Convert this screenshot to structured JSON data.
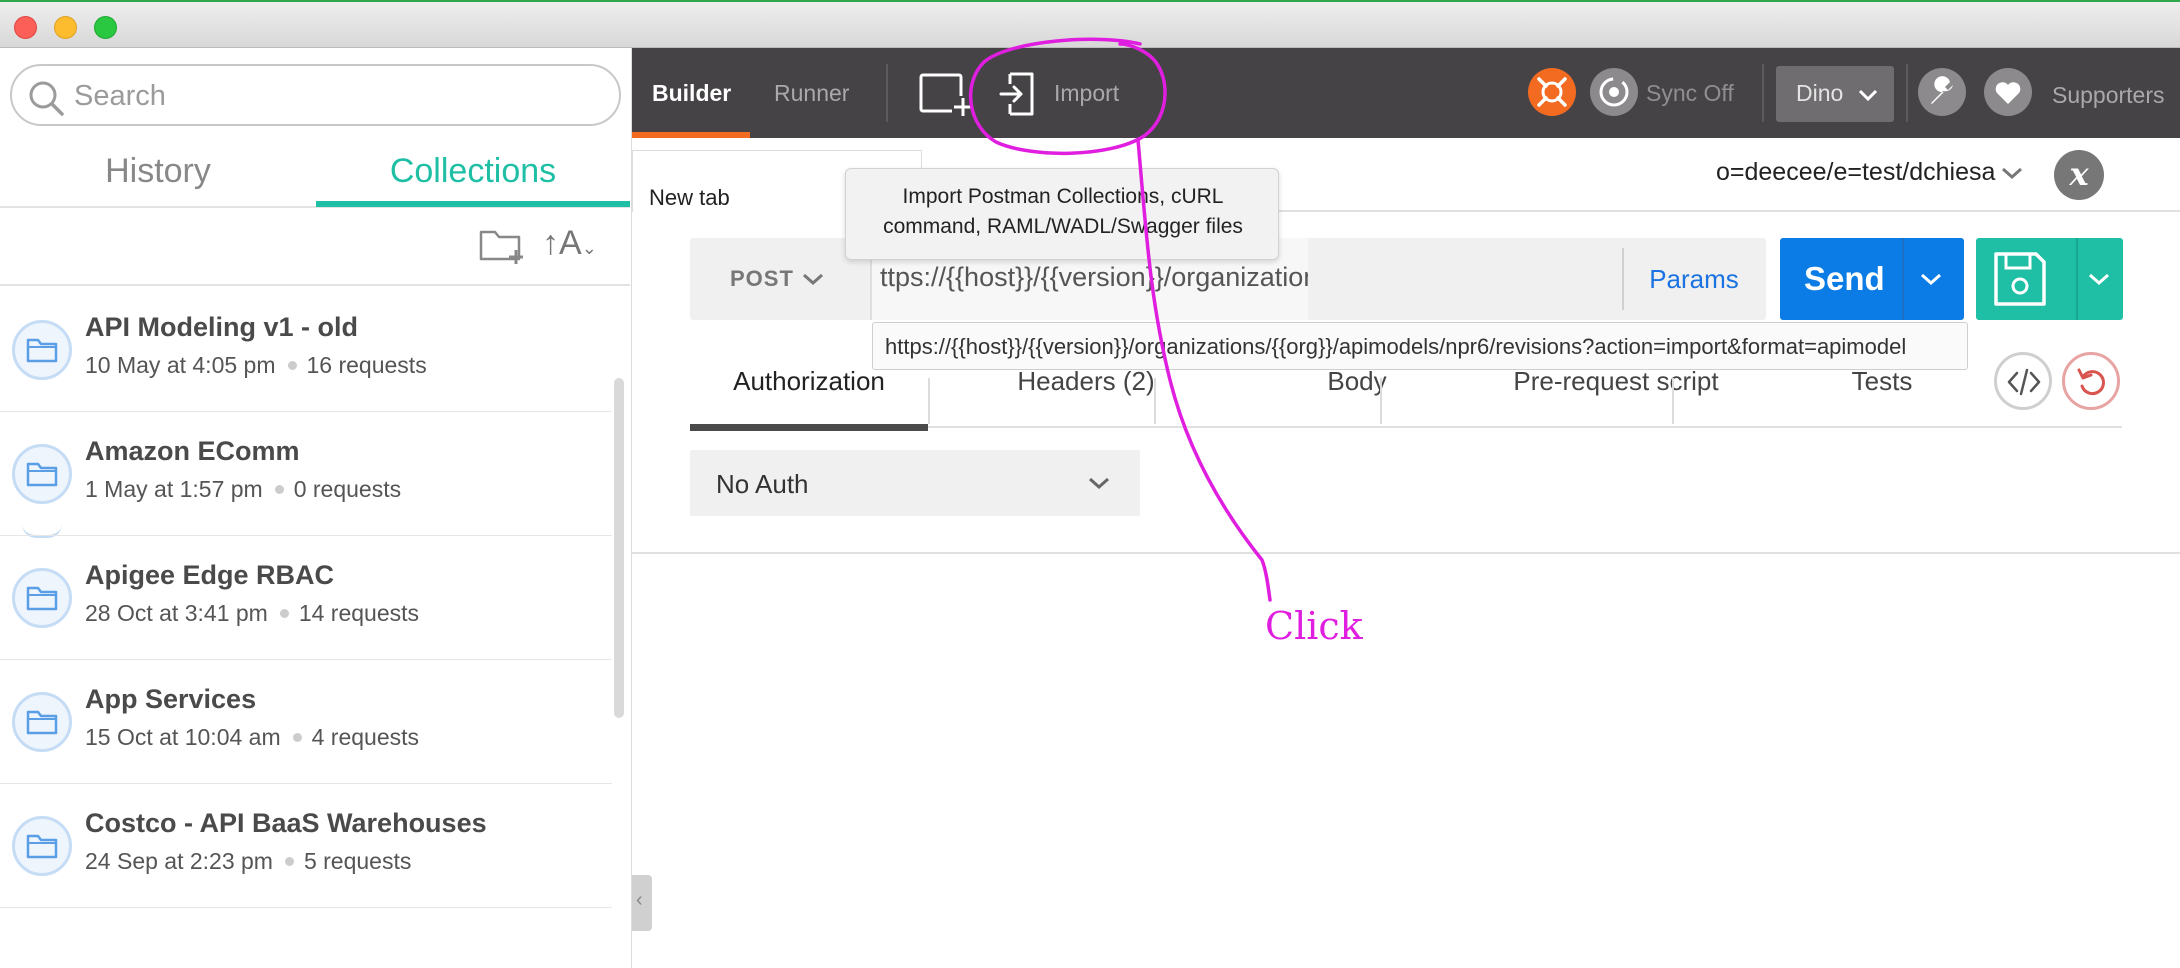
{
  "sidebar": {
    "search_placeholder": "Search",
    "tabs": {
      "history": "History",
      "collections": "Collections"
    },
    "sort_label": "↑A",
    "collections": [
      {
        "name": "API Modeling v1 - old",
        "date": "10 May at 4:05 pm",
        "requests": "16 requests"
      },
      {
        "name": "Amazon EComm",
        "date": "1 May at 1:57 pm",
        "requests": "0 requests"
      },
      {
        "name": "Apigee Edge RBAC",
        "date": "28 Oct at 3:41 pm",
        "requests": "14 requests"
      },
      {
        "name": "App Services",
        "date": "15 Oct at 10:04 am",
        "requests": "4 requests"
      },
      {
        "name": "Costco - API BaaS Warehouses",
        "date": "24 Sep at 2:23 pm",
        "requests": "5 requests"
      }
    ]
  },
  "toolbar": {
    "builder": "Builder",
    "runner": "Runner",
    "import": "Import",
    "sync": "Sync Off",
    "user": "Dino",
    "supporters": "Supporters"
  },
  "tabstrip": {
    "tab_label": "New tab",
    "environment": "o=deecee/e=test/dchiesa",
    "env_clear": "x"
  },
  "request": {
    "method": "POST",
    "url_display": "ttps://{{host}}/{{version}}/organizations/{{org}}/apimodels/npr6/",
    "url_full": "https://{{host}}/{{version}}/organizations/{{org}}/apimodels/npr6/revisions?action=import&format=apimodel",
    "params": "Params",
    "send": "Send"
  },
  "subtabs": {
    "authorization": "Authorization",
    "headers": "Headers (2)",
    "body": "Body",
    "prerequest": "Pre-request script",
    "tests": "Tests"
  },
  "auth": {
    "selected": "No Auth"
  },
  "import_tooltip": {
    "line1": "Import Postman Collections, cURL",
    "line2": "command, RAML/WADL/Swagger files"
  },
  "annotation": {
    "label": "Click",
    "color": "#e01ee0"
  },
  "colors": {
    "accent_teal": "#1ebfa5",
    "send_blue": "#0b7ce6",
    "orange": "#f26b21",
    "toolbar_bg": "#464346"
  }
}
